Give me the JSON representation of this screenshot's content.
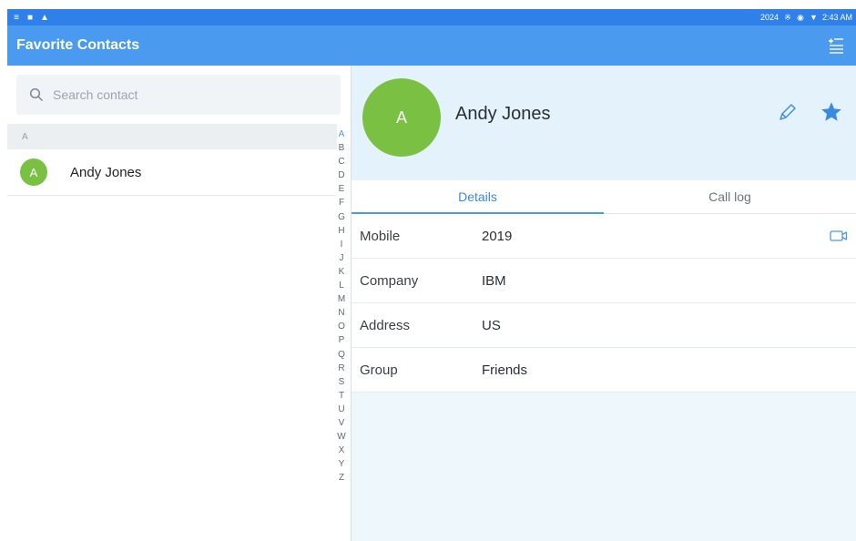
{
  "status_bar": {
    "left_icons": [
      "sim-icon",
      "storage-icon",
      "alert-icon"
    ],
    "year": "2024",
    "time": "2:43 AM",
    "right_icons": [
      "bluetooth-icon",
      "sync-icon",
      "wifi-icon"
    ]
  },
  "app_bar": {
    "title": "Favorite Contacts",
    "action_icon": "add-list-icon"
  },
  "search": {
    "placeholder": "Search contact",
    "icon": "search-icon"
  },
  "contacts": {
    "section_header": "A",
    "items": [
      {
        "initial": "A",
        "name": "Andy Jones"
      }
    ]
  },
  "alphabet": [
    "A",
    "B",
    "C",
    "D",
    "E",
    "F",
    "G",
    "H",
    "I",
    "J",
    "K",
    "L",
    "M",
    "N",
    "O",
    "P",
    "Q",
    "R",
    "S",
    "T",
    "U",
    "V",
    "W",
    "X",
    "Y",
    "Z"
  ],
  "alphabet_active": "A",
  "profile": {
    "initial": "A",
    "name": "Andy Jones",
    "edit_icon": "pencil-icon",
    "favorite_icon": "star-icon"
  },
  "tabs": [
    {
      "label": "Details",
      "active": true
    },
    {
      "label": "Call log",
      "active": false
    }
  ],
  "details": [
    {
      "label": "Mobile",
      "value": "2019"
    },
    {
      "label": "Company",
      "value": "IBM"
    },
    {
      "label": "Address",
      "value": "US"
    },
    {
      "label": "Group",
      "value": "Friends"
    }
  ],
  "colors": {
    "status_bar": "#2f80e8",
    "app_bar": "#4a9af0",
    "avatar": "#7ac143",
    "accent": "#3a8bdd"
  }
}
